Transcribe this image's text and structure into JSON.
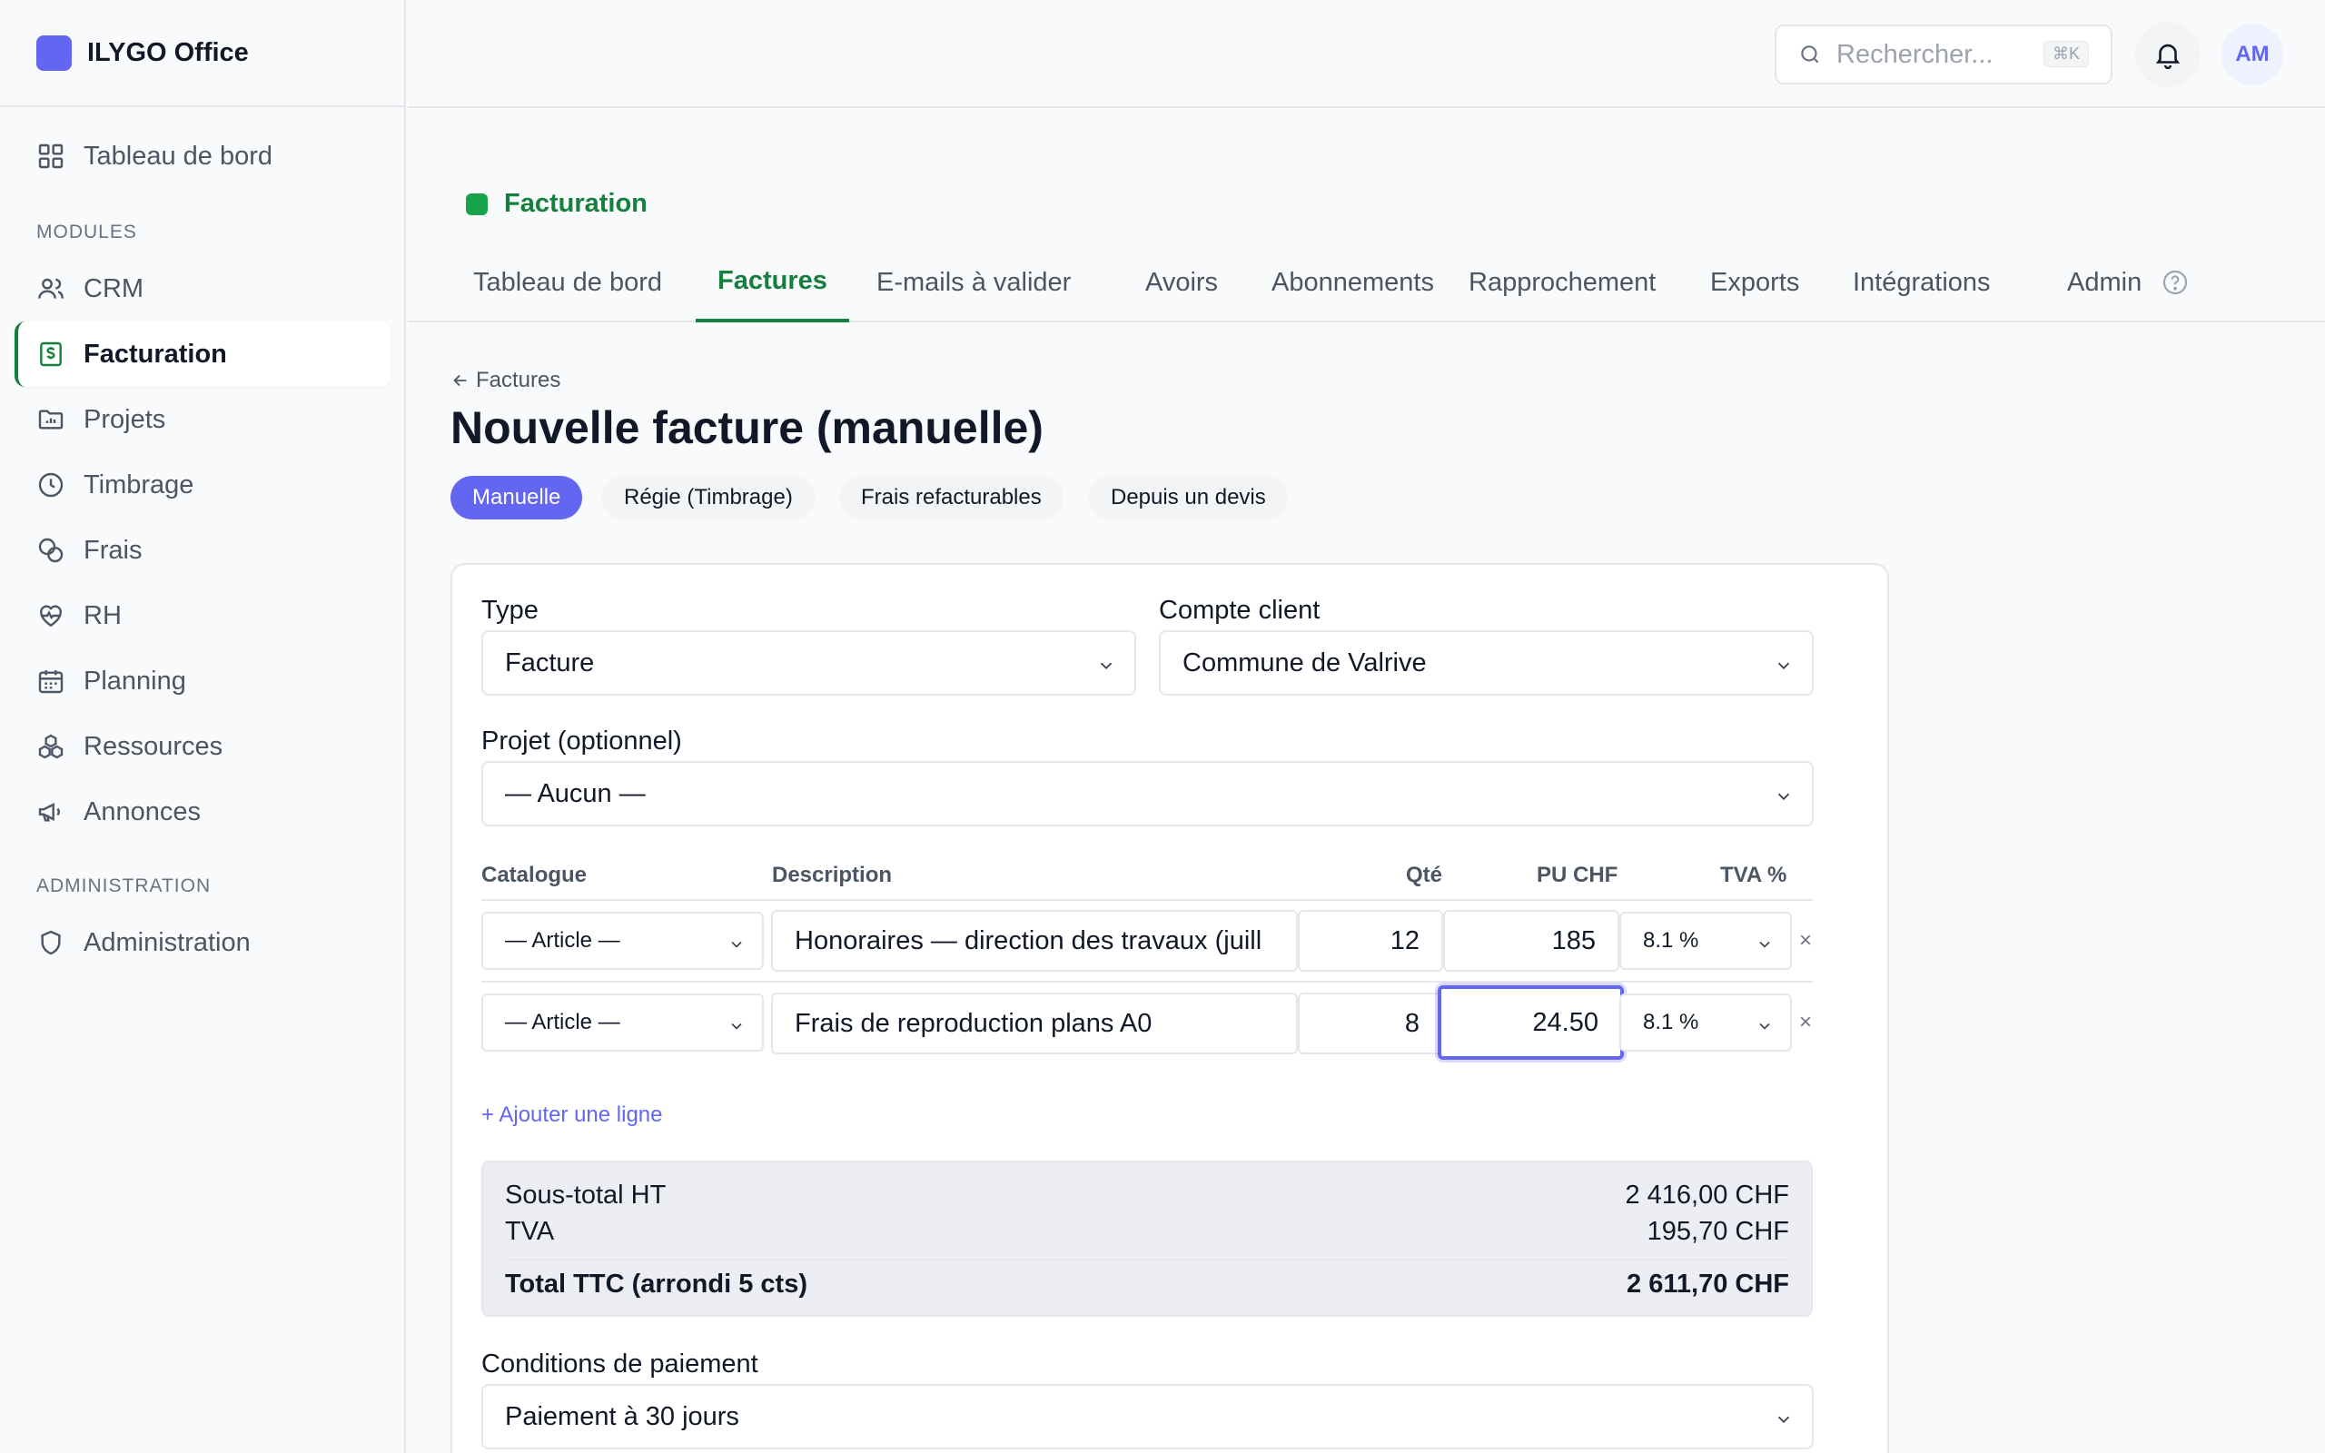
{
  "app": {
    "name": "ILYGO Office"
  },
  "sidebar": {
    "top_item": "Tableau de bord",
    "modules_heading": "MODULES",
    "items": [
      {
        "label": "CRM"
      },
      {
        "label": "Facturation"
      },
      {
        "label": "Projets"
      },
      {
        "label": "Timbrage"
      },
      {
        "label": "Frais"
      },
      {
        "label": "RH"
      },
      {
        "label": "Planning"
      },
      {
        "label": "Ressources"
      },
      {
        "label": "Annonces"
      }
    ],
    "admin_heading": "ADMINISTRATION",
    "admin_item": "Administration"
  },
  "topbar": {
    "search_placeholder": "Rechercher...",
    "search_shortcut": "⌘K",
    "avatar_initials": "AM"
  },
  "module": {
    "title": "Facturation",
    "tabs": [
      {
        "label": "Tableau de bord"
      },
      {
        "label": "Factures"
      },
      {
        "label": "E-mails à valider"
      },
      {
        "label": "Avoirs"
      },
      {
        "label": "Abonnements"
      },
      {
        "label": "Rapprochement"
      },
      {
        "label": "Exports"
      },
      {
        "label": "Intégrations"
      },
      {
        "label": "Admin"
      }
    ],
    "active_tab": "Factures"
  },
  "page": {
    "back_label": "Factures",
    "title": "Nouvelle facture (manuelle)",
    "modes": [
      {
        "label": "Manuelle"
      },
      {
        "label": "Régie (Timbrage)"
      },
      {
        "label": "Frais refacturables"
      },
      {
        "label": "Depuis un devis"
      }
    ],
    "active_mode": "Manuelle"
  },
  "form": {
    "type_label": "Type",
    "type_value": "Facture",
    "client_label": "Compte client",
    "client_value": "Commune de Valrive",
    "project_label": "Projet (optionnel)",
    "project_value": "— Aucun —",
    "columns": {
      "catalogue": "Catalogue",
      "description": "Description",
      "qty": "Qté",
      "unit_price": "PU CHF",
      "vat": "TVA %"
    },
    "lines": [
      {
        "catalogue": "— Article —",
        "description": "Honoraires — direction des travaux (juill",
        "qty": "12",
        "unit_price": "185",
        "vat": "8.1 %",
        "remove": "×"
      },
      {
        "catalogue": "— Article —",
        "description": "Frais de reproduction plans A0",
        "qty": "8",
        "unit_price": "24.50",
        "vat": "8.1 %",
        "remove": "×"
      }
    ],
    "add_line_label": "+ Ajouter une ligne",
    "totals": {
      "subtotal_label": "Sous-total HT",
      "subtotal_value": "2 416,00 CHF",
      "vat_label": "TVA",
      "vat_value": "195,70 CHF",
      "total_label": "Total TTC (arrondi 5 cts)",
      "total_value": "2 611,70 CHF"
    },
    "payment_label": "Conditions de paiement",
    "payment_value": "Paiement à 30 jours"
  },
  "colors": {
    "accent": "#6366f1",
    "module_green": "#15803d",
    "border": "#e5e7eb"
  }
}
